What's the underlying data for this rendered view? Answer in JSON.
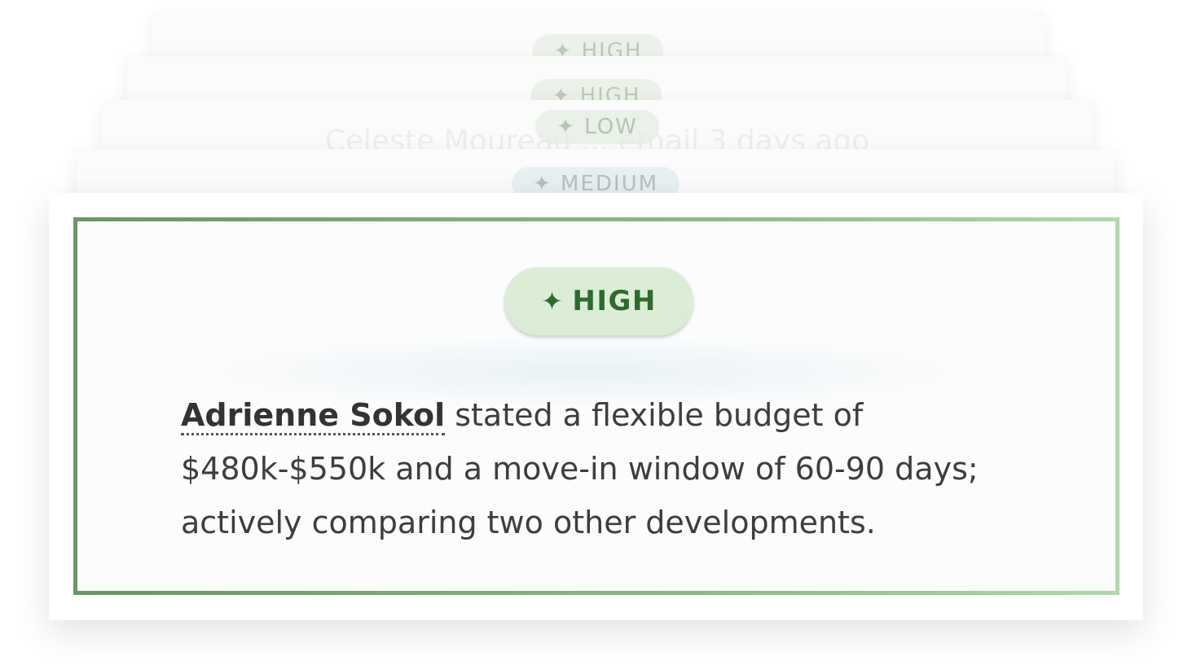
{
  "stack": [
    {
      "badge": "✦ HIGH"
    },
    {
      "badge": "✦ HIGH"
    },
    {
      "badge": "✦ LOW",
      "text": "Celeste Moureau ... email 3 days ago"
    },
    {
      "badge": "✦ MEDIUM"
    }
  ],
  "card": {
    "badge_icon": "✦",
    "badge_label": "HIGH",
    "person_name": "Adrienne Sokol",
    "insight_text": " stated a flexible budget of $480k-$550k and a move-in window of 60-90 days; actively comparing two other developments."
  },
  "colors": {
    "badge_bg": "#dcedd7",
    "badge_text": "#2e6a2c",
    "frame_start": "#6b9468",
    "frame_end": "#b2d6ad"
  }
}
